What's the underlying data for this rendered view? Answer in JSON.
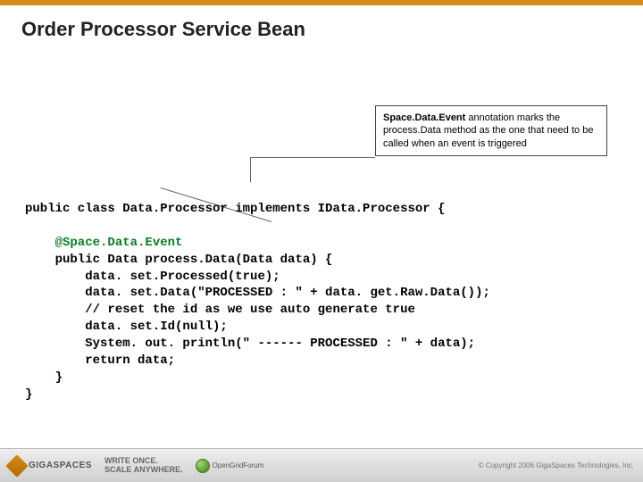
{
  "title": "Order Processor Service Bean",
  "callout": {
    "lead": "Space.Data.Event",
    "body": "annotation marks the process.Data method as the one that need to be called when an event is triggered"
  },
  "code": {
    "l1": "public class Data.Processor implements IData.Processor {",
    "l2": "",
    "l3": "    @Space.Data.Event",
    "l4": "    public Data process.Data(Data data) {",
    "l5": "        data. set.Processed(true);",
    "l6": "        data. set.Data(\"PROCESSED : \" + data. get.Raw.Data());",
    "l7": "        // reset the id as we use auto generate true",
    "l8": "        data. set.Id(null);",
    "l9": "        System. out. println(\" ------ PROCESSED : \" + data);",
    "l10": "        return data;",
    "l11": "    }",
    "l12": "}"
  },
  "footer": {
    "brand": "GIGASPACES",
    "tagline1": "WRITE ONCE.",
    "tagline2": "SCALE ANYWHERE.",
    "ogf1": "OpenGridForum",
    "ogf2": "",
    "copyright": "© Copyright 2006 GigaSpaces Technologies, Inc."
  }
}
